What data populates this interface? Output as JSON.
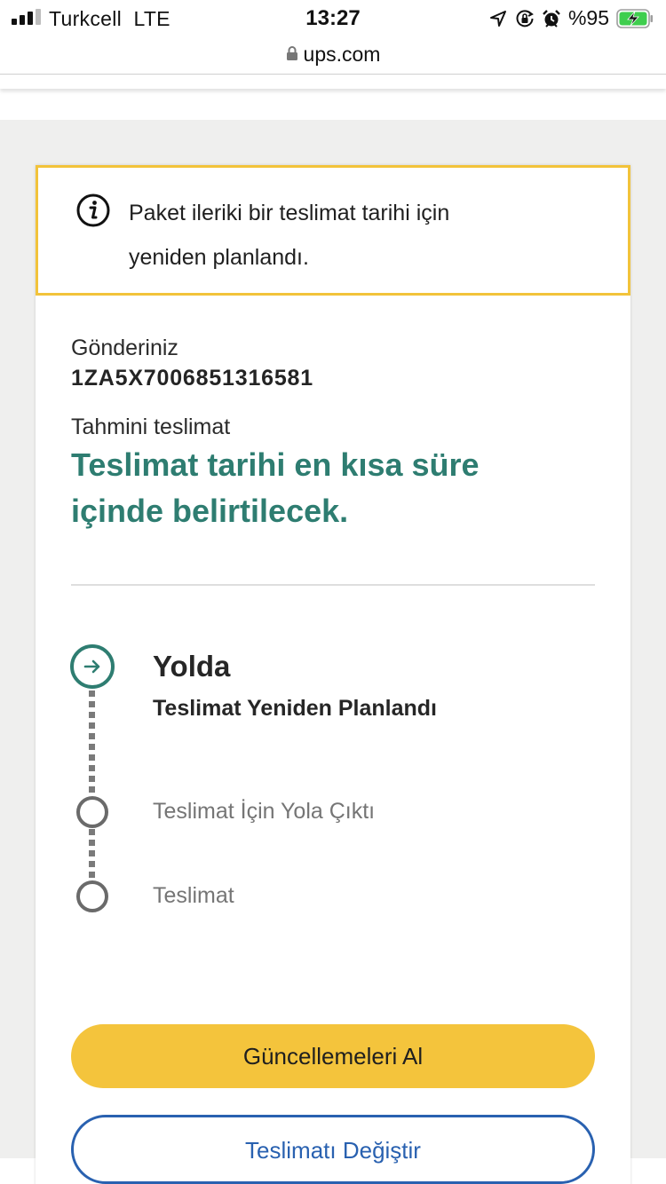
{
  "status_bar": {
    "carrier": "Turkcell",
    "network": "LTE",
    "time": "13:27",
    "battery": "%95",
    "icons": [
      "location-arrow-icon",
      "rotation-lock-icon",
      "alarm-icon",
      "battery-charging-icon"
    ]
  },
  "browser": {
    "url": "ups.com"
  },
  "alert": {
    "message": "Paket ileriki bir teslimat tarihi için yeniden planlandı."
  },
  "shipment": {
    "label": "Gönderiniz",
    "tracking_number": "1ZA5X7006851316581",
    "estimate_label": "Tahmini teslimat",
    "estimate_value": "Teslimat tarihi en kısa süre içinde belirtilecek."
  },
  "timeline": {
    "current_status": "Yolda",
    "current_detail": "Teslimat Yeniden Planlandı",
    "steps": [
      {
        "label": "Teslimat İçin Yola Çıktı"
      },
      {
        "label": "Teslimat"
      }
    ]
  },
  "actions": {
    "get_updates": "Güncellemeleri Al",
    "change_delivery": "Teslimatı Değiştir"
  },
  "colors": {
    "accent_yellow": "#f4c43c",
    "alert_border": "#f2c33a",
    "teal": "#2e7d71",
    "link_blue": "#2961b0"
  }
}
